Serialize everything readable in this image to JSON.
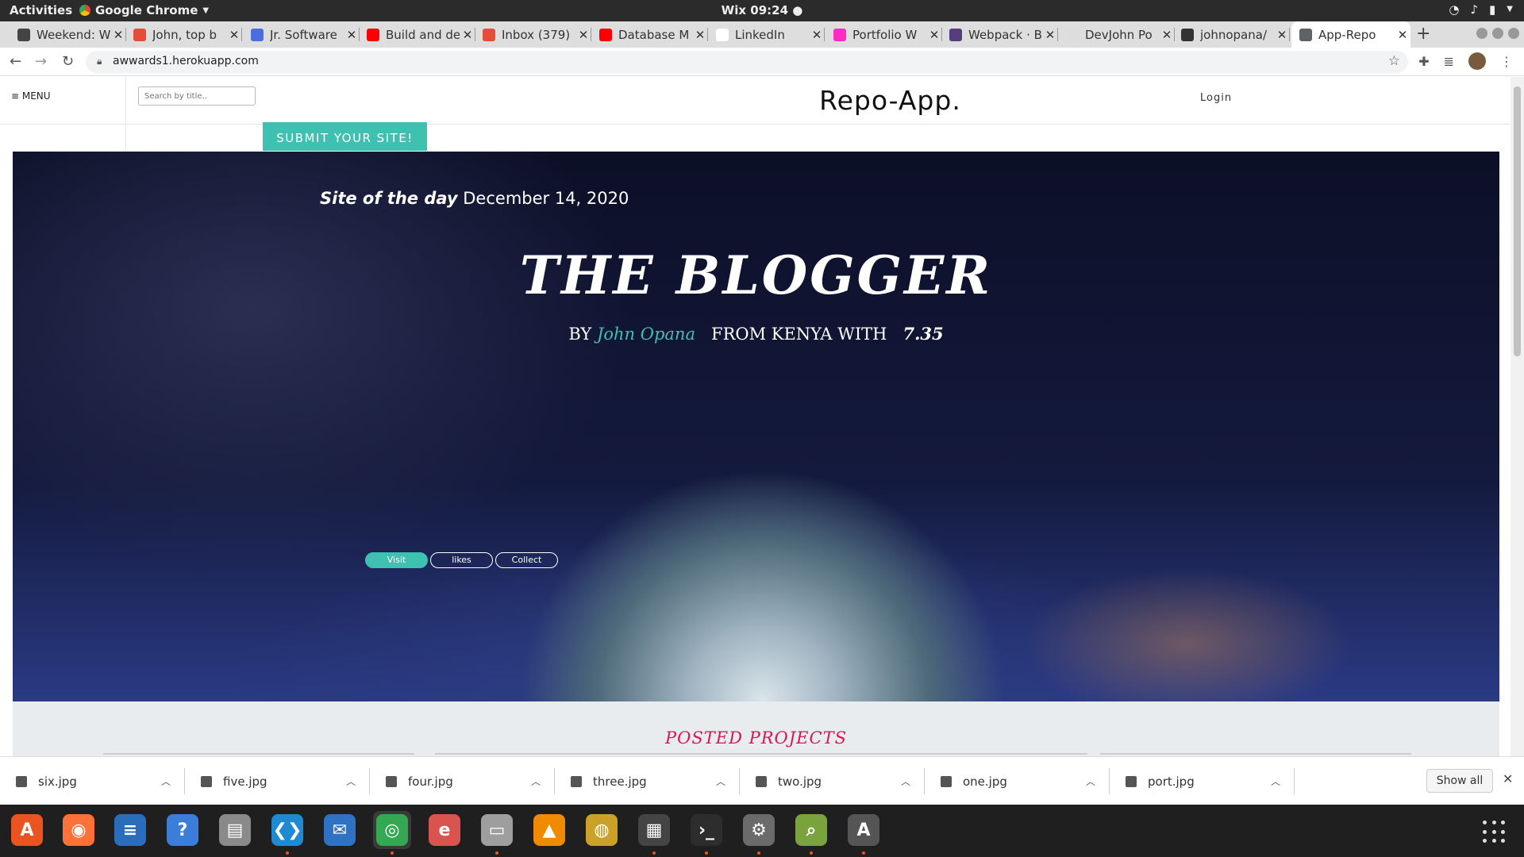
{
  "os": {
    "activities": "Activities",
    "app_name": "Google Chrome",
    "clock": "Wix 09:24 ●"
  },
  "tabs": [
    {
      "title": "Weekend: W",
      "color": "#444444"
    },
    {
      "title": "John, top b",
      "color": "#e44d3a"
    },
    {
      "title": "Jr. Software",
      "color": "#4a6ee0"
    },
    {
      "title": "Build and de",
      "color": "#ff0000"
    },
    {
      "title": "Inbox (379)",
      "color": "#e44d3a"
    },
    {
      "title": "Database M",
      "color": "#ff0000"
    },
    {
      "title": "LinkedIn",
      "color": "#ffffff"
    },
    {
      "title": "Portfolio W",
      "color": "#ff2bc2"
    },
    {
      "title": "Webpack · B",
      "color": "#563d7c"
    },
    {
      "title": "DevJohn Po",
      "color": "#dddddd"
    },
    {
      "title": "johnopana/",
      "color": "#333333"
    },
    {
      "title": "App-Repo",
      "color": "#5f6368"
    }
  ],
  "browser": {
    "url": "awwards1.herokuapp.com"
  },
  "site": {
    "menu": "≡ MENU",
    "search_placeholder": "Search by title..",
    "brand": "Repo-App.",
    "login": "Login",
    "submit": "SUBMIT YOUR SITE!",
    "hero": {
      "sotd_label": "Site of the day",
      "date": "December 14, 2020",
      "title": "THE BLOGGER",
      "by": "BY",
      "author": "John Opana",
      "from": "FROM KENYA WITH",
      "score": "7.35",
      "buttons": [
        "Visit",
        "likes",
        "Collect"
      ]
    },
    "projects_heading": "POSTED PROJECTS"
  },
  "downloads": {
    "files": [
      "six.jpg",
      "five.jpg",
      "four.jpg",
      "three.jpg",
      "two.jpg",
      "one.jpg",
      "port.jpg"
    ],
    "show_all": "Show all"
  },
  "dock": [
    {
      "name": "ubuntu-software-icon",
      "color": "#e95420",
      "glyph": "A",
      "running": false
    },
    {
      "name": "firefox-icon",
      "color": "#ff7139",
      "glyph": "◉",
      "running": false
    },
    {
      "name": "libreoffice-writer-icon",
      "color": "#2a6ebb",
      "glyph": "≡",
      "running": false
    },
    {
      "name": "help-icon",
      "color": "#3c7dd9",
      "glyph": "?",
      "running": false
    },
    {
      "name": "printer-icon",
      "color": "#8a8a8a",
      "glyph": "▤",
      "running": false
    },
    {
      "name": "vscode-icon",
      "color": "#1f8ad2",
      "glyph": "❮❯",
      "running": true
    },
    {
      "name": "thunderbird-icon",
      "color": "#2f72c4",
      "glyph": "✉",
      "running": false
    },
    {
      "name": "chrome-icon",
      "color": "#34a853",
      "glyph": "◎",
      "running": true
    },
    {
      "name": "document-viewer-icon",
      "color": "#d9534f",
      "glyph": "e",
      "running": false
    },
    {
      "name": "files-icon",
      "color": "#9e9e9e",
      "glyph": "▭",
      "running": true
    },
    {
      "name": "vlc-icon",
      "color": "#f08a00",
      "glyph": "▲",
      "running": false
    },
    {
      "name": "rhythmbox-icon",
      "color": "#c9a227",
      "glyph": "◍",
      "running": false
    },
    {
      "name": "video-editor-icon",
      "color": "#444444",
      "glyph": "▦",
      "running": true
    },
    {
      "name": "terminal-icon",
      "color": "#2d2d2d",
      "glyph": "›_",
      "running": true
    },
    {
      "name": "settings-icon",
      "color": "#6b6b6b",
      "glyph": "⚙",
      "running": true
    },
    {
      "name": "image-viewer-icon",
      "color": "#7aa33d",
      "glyph": "⌕",
      "running": true
    },
    {
      "name": "software-updater-icon",
      "color": "#555555",
      "glyph": "A",
      "running": true
    }
  ]
}
